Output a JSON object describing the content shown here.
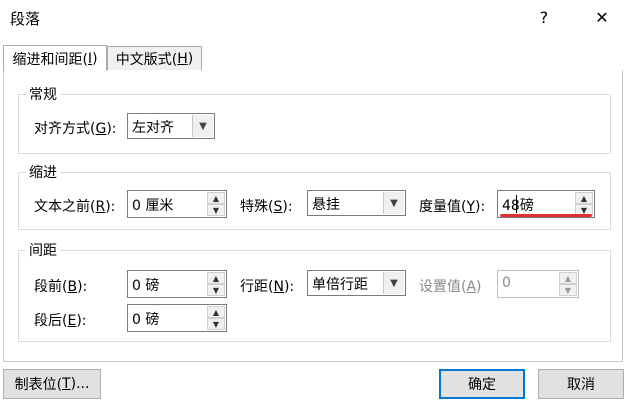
{
  "window": {
    "title": "段落",
    "help_label": "?",
    "close_label": "✕"
  },
  "tabs": [
    {
      "label_pre": "缩进和间距(",
      "key": "I",
      "label_post": ")"
    },
    {
      "label_pre": "中文版式(",
      "key": "H",
      "label_post": ")"
    }
  ],
  "general": {
    "group_label": "常规",
    "alignment": {
      "label_pre": "对齐方式(",
      "key": "G",
      "label_post": "):",
      "value": "左对齐"
    }
  },
  "indent": {
    "group_label": "缩进",
    "before_text": {
      "label_pre": "文本之前(",
      "key": "R",
      "label_post": "):",
      "value": "0 厘米"
    },
    "special": {
      "label_pre": "特殊(",
      "key": "S",
      "label_post": "):",
      "value": "悬挂"
    },
    "measure": {
      "label_pre": "度量值(",
      "key": "Y",
      "label_post": "):",
      "value": "48磅"
    }
  },
  "spacing": {
    "group_label": "间距",
    "before": {
      "label_pre": "段前(",
      "key": "B",
      "label_post": "):",
      "value": "0 磅"
    },
    "after": {
      "label_pre": "段后(",
      "key": "E",
      "label_post": "):",
      "value": "0 磅"
    },
    "line_spacing": {
      "label_pre": "行距(",
      "key": "N",
      "label_post": "):",
      "value": "单倍行距"
    },
    "set_value": {
      "label_pre": "设置值(",
      "key": "A",
      "label_post": ")",
      "value": "0"
    }
  },
  "footer": {
    "tabs_button": {
      "label_pre": "制表位(",
      "key": "T",
      "label_post": ")..."
    },
    "ok_label": "确定",
    "cancel_label": "取消"
  },
  "colors": {
    "annotation_underline": "#e03030",
    "default_button_border": "#0078d7"
  }
}
